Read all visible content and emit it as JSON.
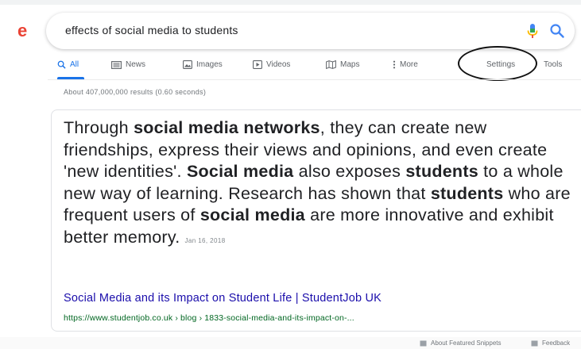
{
  "search": {
    "query": "effects of social media to students"
  },
  "tabs": [
    {
      "label": "All",
      "icon": "search-icon",
      "active": true
    },
    {
      "label": "News",
      "icon": "news-icon",
      "active": false
    },
    {
      "label": "Images",
      "icon": "image-icon",
      "active": false
    },
    {
      "label": "Videos",
      "icon": "video-icon",
      "active": false
    },
    {
      "label": "Maps",
      "icon": "map-icon",
      "active": false
    },
    {
      "label": "More",
      "icon": "more-vertical-icon",
      "active": false
    }
  ],
  "tools": {
    "settings_label": "Settings",
    "tools_label": "Tools"
  },
  "result_stats": "About 407,000,000 results (0.60 seconds)",
  "featured_snippet": {
    "text_html": "Through <b>social media networks</b>, they can create new friendships, express their views and opinions, and even create 'new identities'. <b>Social media</b> also exposes <b>students</b> to a whole new way of learning. Research has shown that <b>students</b> who are frequent users of <b>social media</b> are more innovative and exhibit better memory.",
    "date": "Jan 16, 2018",
    "source_title": "Social Media and its Impact on Student Life | StudentJob UK",
    "source_url": "https://www.studentjob.co.uk › blog › 1833-social-media-and-its-impact-on-..."
  },
  "footer": {
    "about_label": "About Featured Snippets",
    "feedback_label": "Feedback"
  },
  "colors": {
    "accent": "#1a73e8",
    "link": "#1a0dab",
    "url": "#006621",
    "logo_red": "#ea4335"
  }
}
